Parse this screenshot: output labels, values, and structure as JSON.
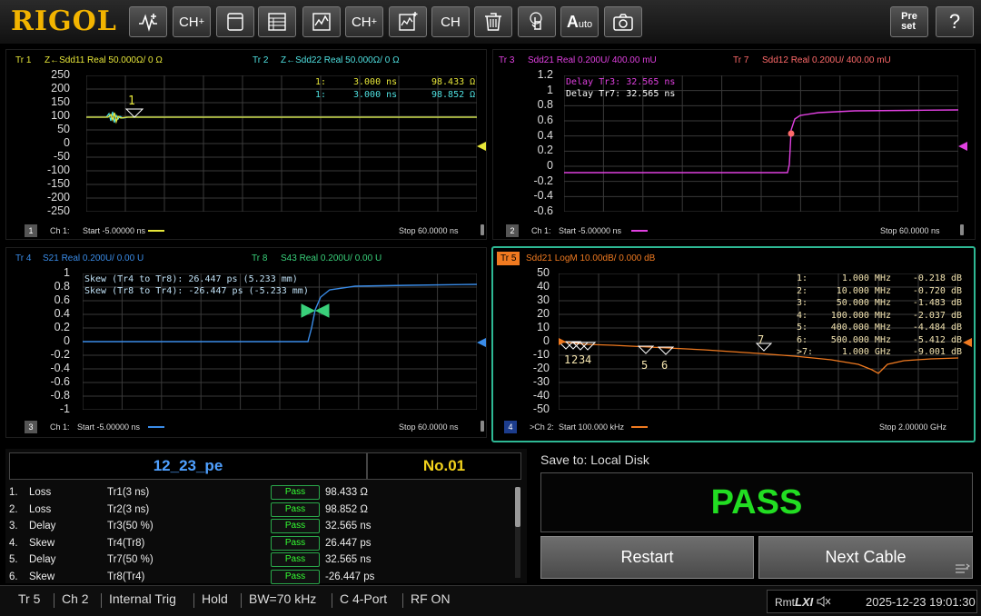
{
  "toolbar": {
    "logo": "RIGOL",
    "buttons": [
      {
        "name": "measure-button",
        "icon": "waveform-plus-icon"
      },
      {
        "name": "channel-add-button",
        "label": "CH",
        "sup": "+"
      },
      {
        "name": "window-button",
        "icon": "window-icon"
      },
      {
        "name": "marker-table-button",
        "icon": "table-icon"
      },
      {
        "name": "trace-button",
        "icon": "trace-icon"
      },
      {
        "name": "channel-copy-button",
        "label": "CH",
        "sup": "+"
      },
      {
        "name": "trace-add-button",
        "icon": "trace-add-icon"
      },
      {
        "name": "channel-button",
        "label": "CH"
      },
      {
        "name": "delete-button",
        "icon": "trash-icon"
      },
      {
        "name": "touch-button",
        "icon": "touch-icon"
      },
      {
        "name": "auto-button",
        "label": "A",
        "sub": "uto"
      },
      {
        "name": "screenshot-button",
        "icon": "camera-icon"
      }
    ],
    "preset_label": "Pre\nset",
    "help_label": "?"
  },
  "panels": {
    "p1": {
      "traces": [
        {
          "id": "Tr 1",
          "desc": "Z←Sdd11 Real 50.000Ω/ 0 Ω",
          "color": "#e6e639"
        },
        {
          "id": "Tr 2",
          "desc": "Z←Sdd22 Real 50.000Ω/ 0 Ω",
          "color": "#4fe0e0"
        }
      ],
      "yticks": [
        "250",
        "200",
        "150",
        "100",
        "50",
        "0",
        "-50",
        "-100",
        "-150",
        "-200",
        "-250"
      ],
      "markers": [
        {
          "label": "1:",
          "x": "3.000 ns",
          "y": "98.433 Ω",
          "color": "#e6e639"
        },
        {
          "label": "1:",
          "x": "3.000 ns",
          "y": "98.852 Ω",
          "color": "#4fe0e0"
        }
      ],
      "marker_num": "1",
      "channel_num": "1",
      "channel": "Ch 1:",
      "start": "Start  -5.00000 ns",
      "stop": "Stop  60.0000 ns",
      "line_color": "#e6e639"
    },
    "p2": {
      "traces": [
        {
          "id": "Tr 3",
          "desc": "Sdd21 Real 0.200U/ 400.00 mU",
          "color": "#e040e0"
        },
        {
          "id": "Tr 7",
          "desc": "Sdd12 Real 0.200U/ 400.00 mU",
          "color": "#ff6a6a"
        }
      ],
      "yticks": [
        "1.2",
        "1",
        "0.8",
        "0.6",
        "0.4",
        "0.2",
        "0",
        "-0.2",
        "-0.4",
        "-0.6"
      ],
      "markers": [
        {
          "text": "Delay Tr3: 32.565 ns",
          "color": "#e040e0"
        },
        {
          "text": "Delay Tr7: 32.565 ns",
          "color": "#ffffff"
        }
      ],
      "channel_num": "2",
      "channel": "Ch 1:",
      "start": "Start  -5.00000 ns",
      "stop": "Stop  60.0000 ns",
      "line_color": "#e040e0"
    },
    "p3": {
      "traces": [
        {
          "id": "Tr 4",
          "desc": "S21 Real 0.200U/ 0.00 U",
          "color": "#3a8ce8"
        },
        {
          "id": "Tr 8",
          "desc": "S43 Real 0.200U/ 0.00 U",
          "color": "#39d07a"
        }
      ],
      "yticks": [
        "1",
        "0.8",
        "0.6",
        "0.4",
        "0.2",
        "0",
        "-0.2",
        "-0.4",
        "-0.6",
        "-0.8",
        "-1"
      ],
      "markers": [
        {
          "text": "Skew (Tr4 to Tr8): 26.447 ps (5.233 mm)",
          "color": "#bfe0f5"
        },
        {
          "text": "Skew (Tr8 to Tr4): -26.447 ps (-5.233 mm)",
          "color": "#bfe0f5"
        }
      ],
      "channel_num": "3",
      "channel": "Ch 1:",
      "start": "Start  -5.00000 ns",
      "stop": "Stop  60.0000 ns",
      "line_color": "#3a8ce8"
    },
    "p4": {
      "traces": [
        {
          "id": "Tr 5",
          "desc": "Sdd21 LogM 10.00dB/ 0.000 dB",
          "color": "#f07a20"
        }
      ],
      "yticks": [
        "50",
        "40",
        "30",
        "20",
        "10",
        "0",
        "-10",
        "-20",
        "-30",
        "-40",
        "-50"
      ],
      "markers": [
        {
          "n": "1:",
          "f": "1.000 MHz",
          "v": "-0.218 dB"
        },
        {
          "n": "2:",
          "f": "10.000 MHz",
          "v": "-0.720 dB"
        },
        {
          "n": "3:",
          "f": "50.000 MHz",
          "v": "-1.483 dB"
        },
        {
          "n": "4:",
          "f": "100.000 MHz",
          "v": "-2.037 dB"
        },
        {
          "n": "5:",
          "f": "400.000 MHz",
          "v": "-4.484 dB"
        },
        {
          "n": "6:",
          "f": "500.000 MHz",
          "v": "-5.412 dB"
        },
        {
          "n": ">7:",
          "f": "1.000 GHz",
          "v": "-9.001 dB"
        }
      ],
      "marker_nums": [
        "1",
        "2",
        "3",
        "4",
        "5",
        "6",
        "7"
      ],
      "channel_num": "4",
      "channel": ">Ch 2:",
      "start": "Start  100.000 kHz",
      "stop": "Stop  2.00000 GHz",
      "line_color": "#f07a20"
    }
  },
  "results": {
    "name": "12_23_pe",
    "number": "No.01",
    "rows": [
      {
        "idx": "1.",
        "type": "Loss",
        "trace": "Tr1(3 ns)",
        "result": "Pass",
        "value": "98.433 Ω"
      },
      {
        "idx": "2.",
        "type": "Loss",
        "trace": "Tr2(3 ns)",
        "result": "Pass",
        "value": "98.852 Ω"
      },
      {
        "idx": "3.",
        "type": "Delay",
        "trace": "Tr3(50 %)",
        "result": "Pass",
        "value": "32.565 ns"
      },
      {
        "idx": "4.",
        "type": "Skew",
        "trace": "Tr4(Tr8)",
        "result": "Pass",
        "value": "26.447 ps"
      },
      {
        "idx": "5.",
        "type": "Delay",
        "trace": "Tr7(50 %)",
        "result": "Pass",
        "value": "32.565 ns"
      },
      {
        "idx": "6.",
        "type": "Skew",
        "trace": "Tr8(Tr4)",
        "result": "Pass",
        "value": "-26.447 ps"
      }
    ]
  },
  "right": {
    "save_to": "Save to: Local Disk",
    "verdict": "PASS",
    "restart": "Restart",
    "next": "Next Cable"
  },
  "status": {
    "items": [
      "Tr 5",
      "Ch 2",
      "Internal Trig",
      "Hold",
      "BW=70 kHz",
      "C 4-Port",
      "RF ON"
    ],
    "rmt": "Rmt",
    "lxi": "LXI",
    "datetime": "2025-12-23 19:01:30"
  }
}
